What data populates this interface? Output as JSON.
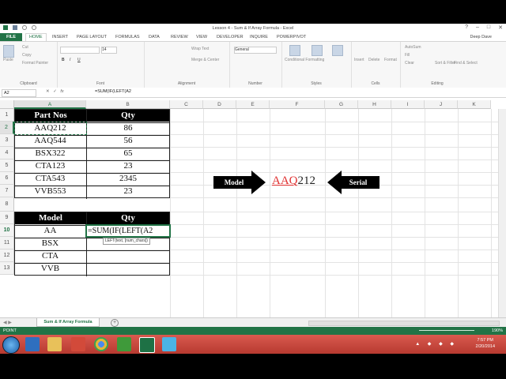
{
  "window": {
    "title": "Lesson 4 - Sum & If Array Formula - Excel",
    "user": "Deep Dave"
  },
  "ribbon_tabs": [
    "FILE",
    "HOME",
    "INSERT",
    "PAGE LAYOUT",
    "FORMULAS",
    "DATA",
    "REVIEW",
    "VIEW",
    "DEVELOPER",
    "INQUIRE",
    "POWERPIVOT"
  ],
  "ribbon": {
    "clipboard": {
      "cut": "Cut",
      "copy": "Copy",
      "paste": "Paste",
      "painter": "Format Painter",
      "label": "Clipboard"
    },
    "font": {
      "size": "14",
      "label": "Font"
    },
    "alignment": {
      "wrap": "Wrap Text",
      "merge": "Merge & Center",
      "label": "Alignment"
    },
    "number": {
      "format": "General",
      "label": "Number"
    },
    "styles": {
      "cond": "Conditional Formatting",
      "table": "Format as Table",
      "cell": "Cell Styles",
      "label": "Styles"
    },
    "cells": {
      "insert": "Insert",
      "delete": "Delete",
      "format": "Format",
      "label": "Cells"
    },
    "editing": {
      "autosum": "AutoSum",
      "fill": "Fill",
      "clear": "Clear",
      "sort": "Sort & Filter",
      "find": "Find & Select",
      "label": "Editing"
    }
  },
  "formula_bar": {
    "name_box": "A2",
    "formula": "=SUM(IF(LEFT(A2"
  },
  "columns": [
    "A",
    "B",
    "C",
    "D",
    "E",
    "F",
    "G",
    "H",
    "I",
    "J",
    "K"
  ],
  "rows": [
    "1",
    "2",
    "3",
    "4",
    "5",
    "6",
    "7",
    "8",
    "9",
    "10",
    "11",
    "12",
    "13"
  ],
  "table1": {
    "headers": [
      "Part Nos",
      "Qty"
    ],
    "rows": [
      [
        "AAQ212",
        "86"
      ],
      [
        "AAQ544",
        "56"
      ],
      [
        "BSX322",
        "65"
      ],
      [
        "CTA123",
        "23"
      ],
      [
        "CTA543",
        "2345"
      ],
      [
        "VVB553",
        "23"
      ]
    ]
  },
  "table2": {
    "headers": [
      "Model",
      "Qty"
    ],
    "rows": [
      [
        "AA",
        "=SUM(IF(LEFT(A2"
      ],
      [
        "BSX",
        ""
      ],
      [
        "CTA",
        ""
      ],
      [
        "VVB",
        ""
      ]
    ],
    "tooltip": "LEFT(text, [num_chars])"
  },
  "diagram": {
    "left_label": "Model",
    "value_part_model": "AAQ",
    "value_part_serial": "212",
    "right_label": "Serial"
  },
  "sheet_tab": "Sum & If Array Formula",
  "status": {
    "mode": "POINT",
    "zoom": "190%"
  },
  "taskbar": {
    "time": "7:57 PM",
    "date": "2/20/2014"
  }
}
